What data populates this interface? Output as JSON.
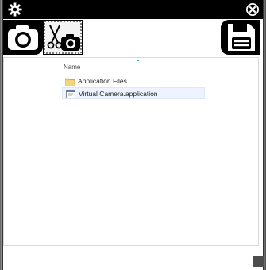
{
  "list": {
    "column_header": "Name",
    "items": [
      {
        "label": "Application Files",
        "icon": "folder-icon"
      },
      {
        "label": "Virtual Camera.application",
        "icon": "application-icon"
      }
    ]
  },
  "colors": {
    "titlebar": "#000000",
    "background": "#ffffff",
    "selection": "#eef4ff"
  },
  "icons": {
    "settings": "gear-icon",
    "close": "close-icon",
    "camera": "camera-icon",
    "capture": "scissors-camera-icon",
    "save": "floppy-disk-icon",
    "resize": "resize-grip-icon"
  }
}
